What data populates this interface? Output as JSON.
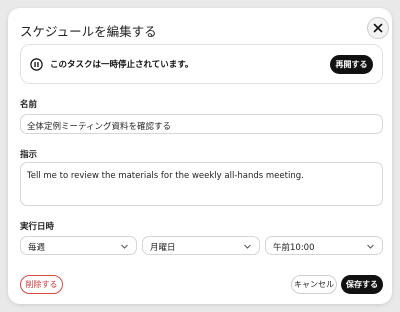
{
  "dialog": {
    "title": "スケジュールを編集する",
    "close_icon": "close-icon"
  },
  "banner": {
    "icon": "pause-icon",
    "text": "このタスクは一時停止されています。",
    "resume_label": "再開する"
  },
  "name": {
    "label": "名前",
    "value": "全体定例ミーティング資料を確認する"
  },
  "instructions": {
    "label": "指示",
    "value": "Tell me to review the materials for the weekly all-hands meeting."
  },
  "schedule": {
    "label": "実行日時",
    "frequency": "毎週",
    "day": "月曜日",
    "time": "午前10:00"
  },
  "footer": {
    "delete_label": "削除する",
    "cancel_label": "キャンセル",
    "save_label": "保存する"
  },
  "colors": {
    "primary": "#111111",
    "danger": "#c73a3a"
  }
}
